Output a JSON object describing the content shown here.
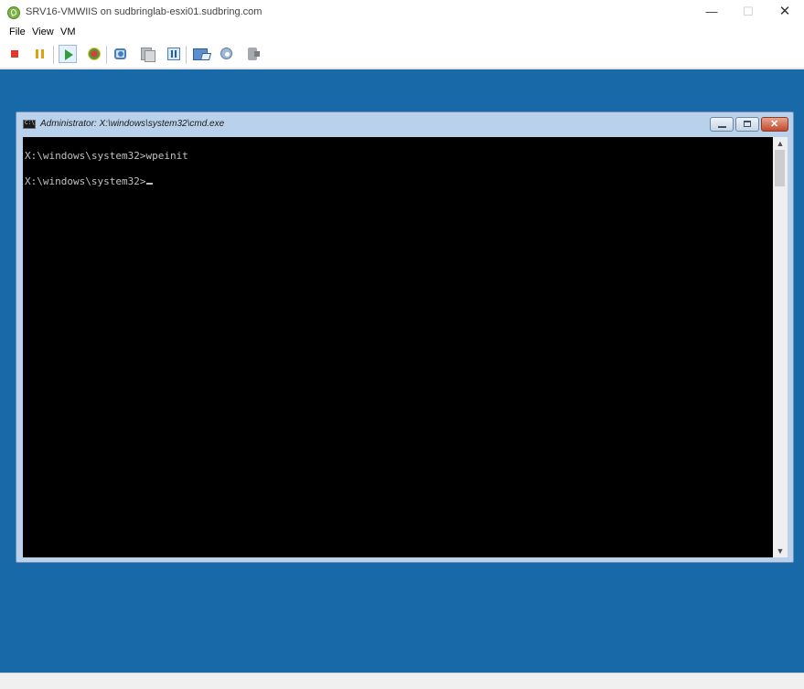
{
  "window": {
    "title": "SRV16-VMWIIS on sudbringlab-esxi01.sudbring.com",
    "controls": {
      "minimize": "—",
      "maximize": "☐",
      "close": "✕"
    }
  },
  "menu": {
    "items": [
      {
        "label": "File"
      },
      {
        "label": "View"
      },
      {
        "label": "VM"
      }
    ]
  },
  "toolbar": {
    "buttons": [
      {
        "icon": "power-off-icon"
      },
      {
        "icon": "suspend-icon"
      },
      {
        "icon": "power-on-icon",
        "state": "active"
      },
      {
        "icon": "reset-icon"
      },
      {
        "icon": "take-snapshot-icon"
      },
      {
        "icon": "snapshot-manager-icon"
      },
      {
        "icon": "revert-snapshot-icon"
      },
      {
        "icon": "send-to-console-icon"
      },
      {
        "icon": "vm-settings-icon"
      },
      {
        "icon": "ctrl-alt-del-icon"
      }
    ]
  },
  "guest": {
    "background_color": "#1769a7",
    "cmd_window": {
      "title": "Administrator: X:\\windows\\system32\\cmd.exe",
      "lines": [
        "X:\\windows\\system32>wpeinit",
        "X:\\windows\\system32>"
      ],
      "scroll": {
        "up": "▲",
        "down": "▼"
      }
    }
  }
}
